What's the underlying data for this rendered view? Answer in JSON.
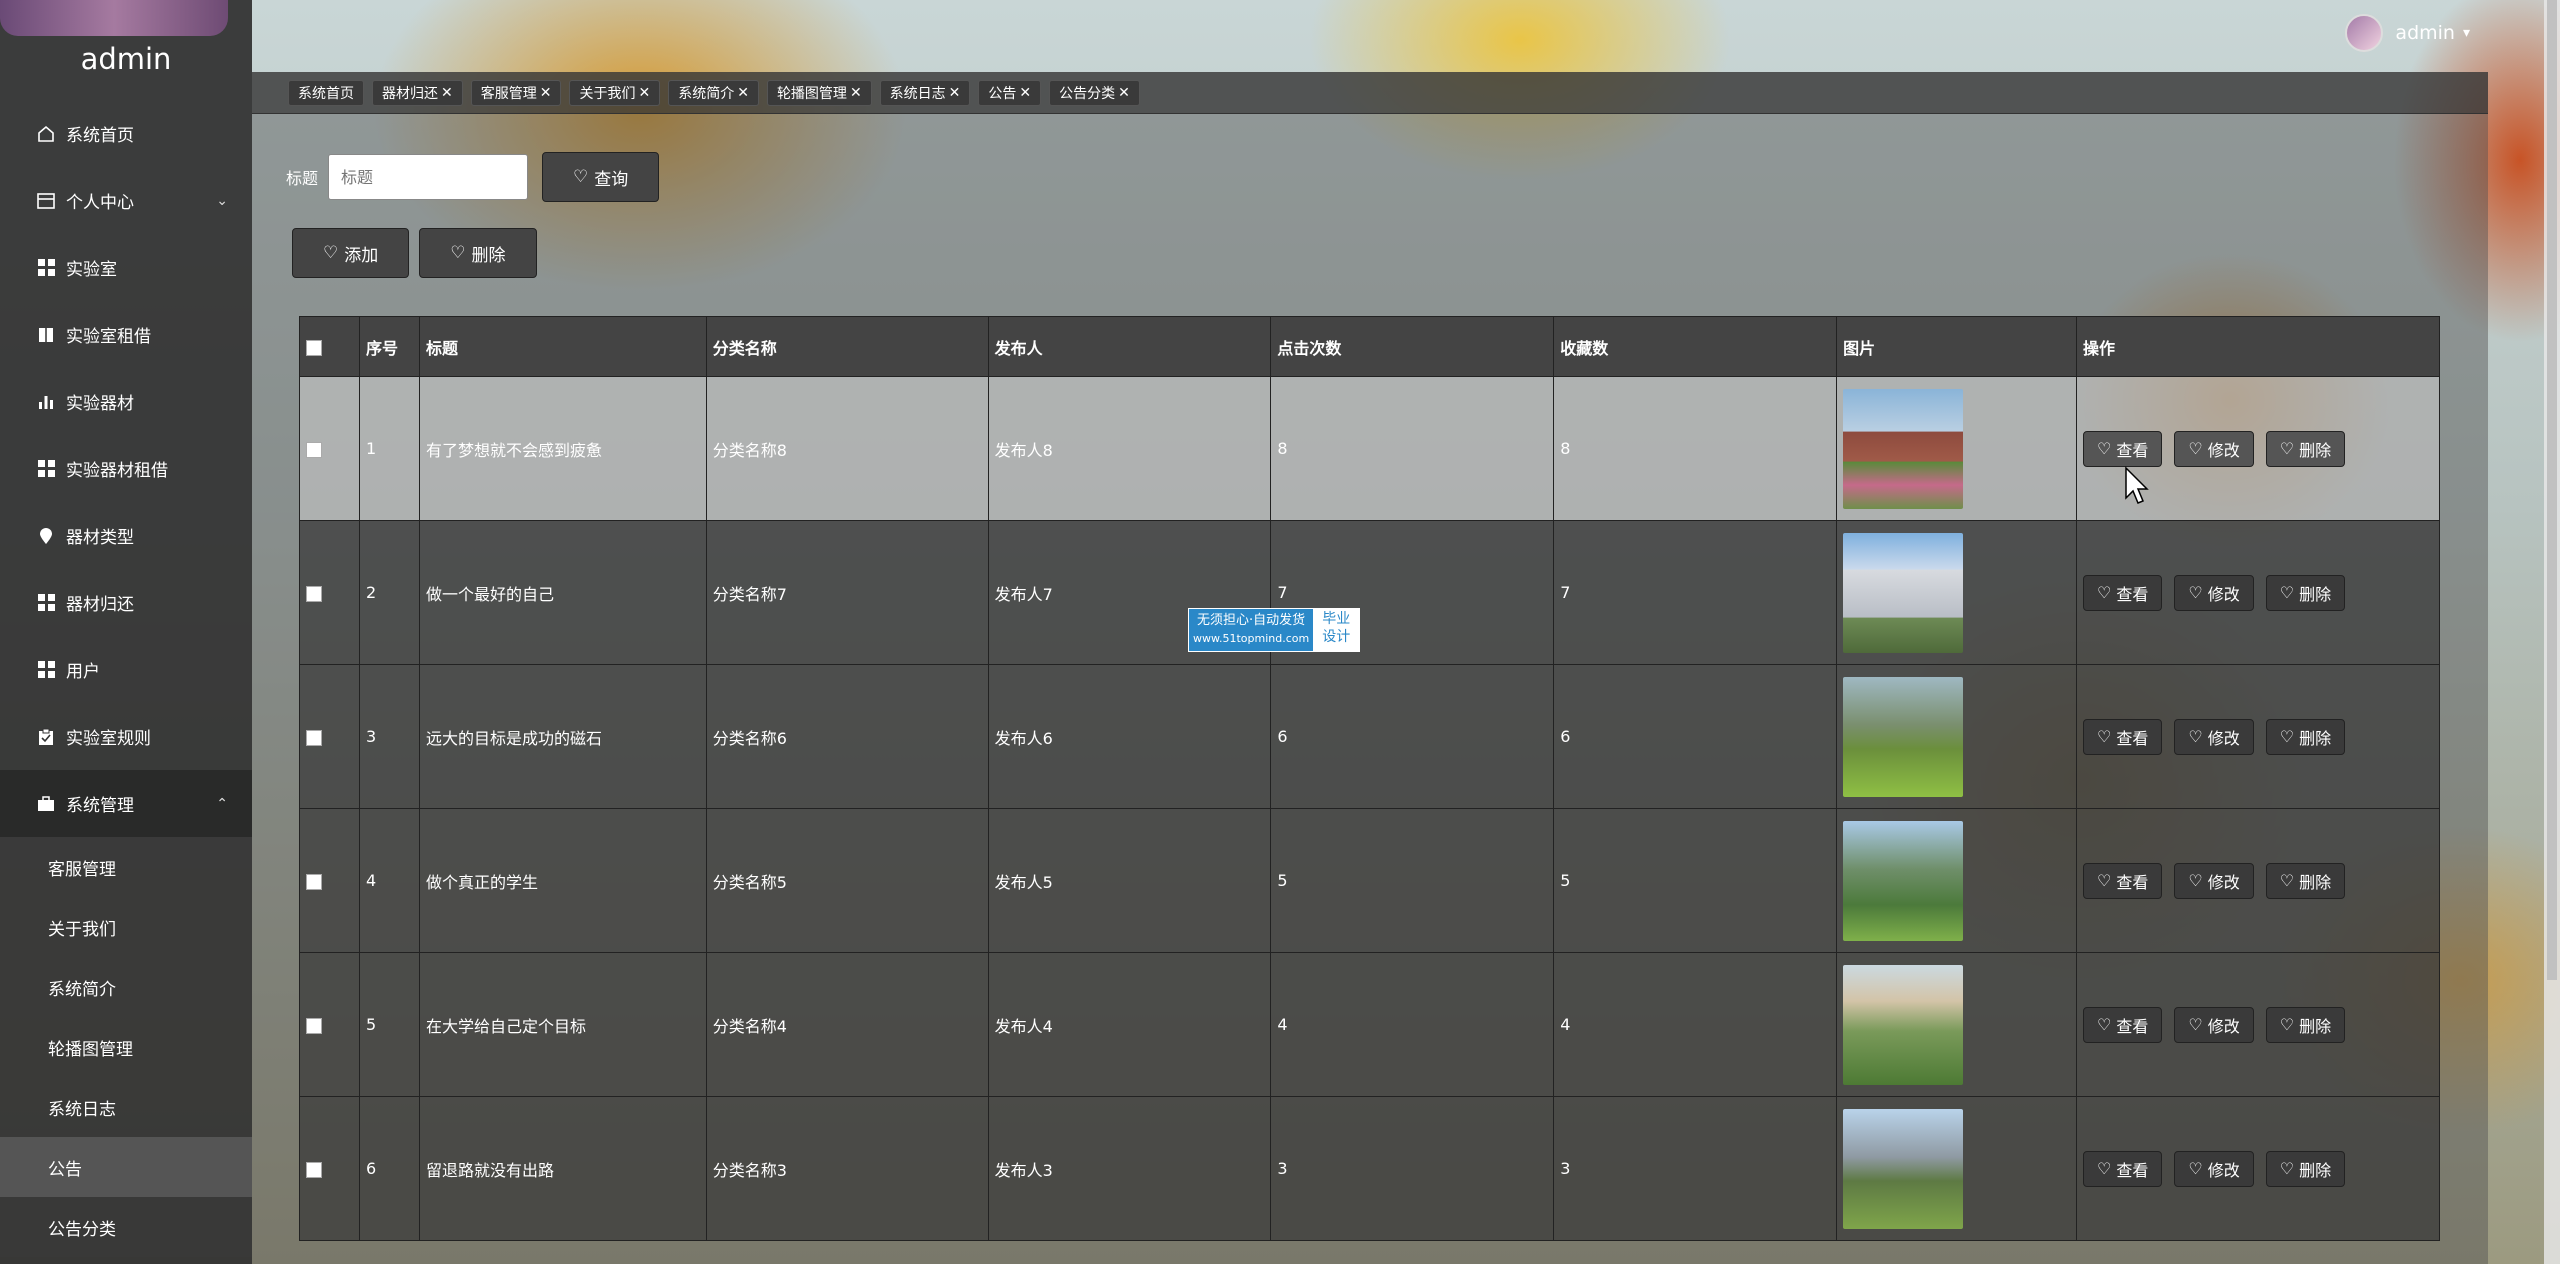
{
  "app": {
    "title": "admin"
  },
  "header": {
    "username": "admin",
    "caret": "▾"
  },
  "sidebar": {
    "items": [
      {
        "label": "系统首页",
        "icon": "home-icon"
      },
      {
        "label": "个人中心",
        "icon": "id-card-icon",
        "chevron": "⌄"
      },
      {
        "label": "实验室",
        "icon": "grid-icon"
      },
      {
        "label": "实验室租借",
        "icon": "book-icon"
      },
      {
        "label": "实验器材",
        "icon": "bar-chart-icon"
      },
      {
        "label": "实验器材租借",
        "icon": "grid-icon"
      },
      {
        "label": "器材类型",
        "icon": "map-pin-icon"
      },
      {
        "label": "器材归还",
        "icon": "grid-icon"
      },
      {
        "label": "用户",
        "icon": "grid-icon"
      },
      {
        "label": "实验室规则",
        "icon": "clipboard-icon"
      },
      {
        "label": "系统管理",
        "icon": "briefcase-icon",
        "chevron": "⌃"
      }
    ],
    "sub_items": [
      "客服管理",
      "关于我们",
      "系统简介",
      "轮播图管理",
      "系统日志",
      "公告",
      "公告分类"
    ]
  },
  "tabs": [
    "系统首页",
    "器材归还",
    "客服管理",
    "关于我们",
    "系统简介",
    "轮播图管理",
    "系统日志",
    "公告",
    "公告分类"
  ],
  "tab_close": "✕",
  "search": {
    "label": "标题",
    "placeholder": "标题",
    "button": "查询"
  },
  "actions": {
    "add": "添加",
    "delete": "删除"
  },
  "table": {
    "headers": [
      "序号",
      "标题",
      "分类名称",
      "发布人",
      "点击次数",
      "收藏数",
      "图片",
      "操作"
    ],
    "op_labels": {
      "view": "查看",
      "edit": "修改",
      "delete": "删除"
    },
    "rows": [
      {
        "no": "1",
        "title": "有了梦想就不会感到疲惫",
        "category": "分类名称8",
        "publisher": "发布人8",
        "clicks": "8",
        "favorites": "8"
      },
      {
        "no": "2",
        "title": "做一个最好的自己",
        "category": "分类名称7",
        "publisher": "发布人7",
        "clicks": "7",
        "favorites": "7"
      },
      {
        "no": "3",
        "title": "远大的目标是成功的磁石",
        "category": "分类名称6",
        "publisher": "发布人6",
        "clicks": "6",
        "favorites": "6"
      },
      {
        "no": "4",
        "title": "做个真正的学生",
        "category": "分类名称5",
        "publisher": "发布人5",
        "clicks": "5",
        "favorites": "5"
      },
      {
        "no": "5",
        "title": "在大学给自己定个目标",
        "category": "分类名称4",
        "publisher": "发布人4",
        "clicks": "4",
        "favorites": "4"
      },
      {
        "no": "6",
        "title": "留退路就没有出路",
        "category": "分类名称3",
        "publisher": "发布人3",
        "clicks": "3",
        "favorites": "3"
      }
    ]
  },
  "watermark": {
    "left_line1": "无须担心·自动发货",
    "left_line2": "www.51topmind.com",
    "right_line1": "毕业",
    "right_line2": "设计"
  }
}
